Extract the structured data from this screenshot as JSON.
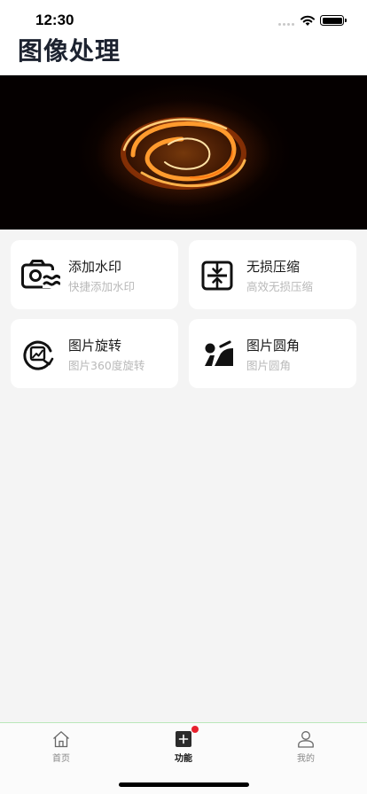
{
  "status_bar": {
    "time": "12:30"
  },
  "header": {
    "title": "图像处理"
  },
  "tools": [
    {
      "title": "添加水印",
      "subtitle": "快捷添加水印",
      "icon": "camera-watermark-icon"
    },
    {
      "title": "无损压缩",
      "subtitle": "高效无损压缩",
      "icon": "compress-icon"
    },
    {
      "title": "图片旋转",
      "subtitle": "图片360度旋转",
      "icon": "rotate-image-icon"
    },
    {
      "title": "图片圆角",
      "subtitle": "图片圆角",
      "icon": "rounded-corner-icon"
    }
  ],
  "tabbar": {
    "tabs": [
      {
        "label": "首页",
        "icon": "home-icon",
        "active": false
      },
      {
        "label": "功能",
        "icon": "plus-square-icon",
        "active": true
      },
      {
        "label": "我的",
        "icon": "user-icon",
        "active": false
      }
    ]
  },
  "colors": {
    "background": "#f4f4f4",
    "card": "#ffffff",
    "badge": "#e8212e",
    "tab_border": "#b9e7b9"
  }
}
